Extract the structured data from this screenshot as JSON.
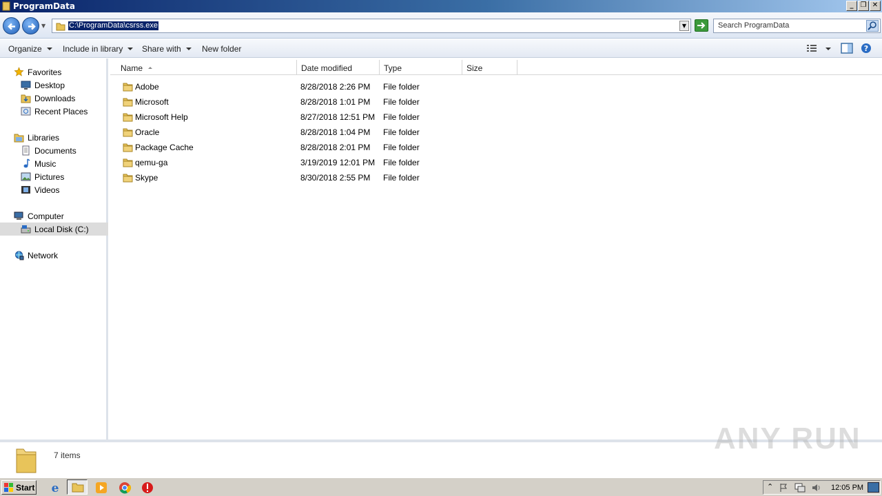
{
  "window": {
    "title": "ProgramData"
  },
  "address": {
    "path": "C:\\ProgramData\\csrss.exe"
  },
  "search": {
    "placeholder": "Search ProgramData"
  },
  "toolbar": {
    "organize": "Organize",
    "include_in_library": "Include in library",
    "share_with": "Share with",
    "new_folder": "New folder"
  },
  "nav": {
    "favorites": "Favorites",
    "desktop": "Desktop",
    "downloads": "Downloads",
    "recent_places": "Recent Places",
    "libraries": "Libraries",
    "documents": "Documents",
    "music": "Music",
    "pictures": "Pictures",
    "videos": "Videos",
    "computer": "Computer",
    "local_disk": "Local Disk (C:)",
    "network": "Network"
  },
  "columns": {
    "name": "Name",
    "date_modified": "Date modified",
    "type": "Type",
    "size": "Size"
  },
  "files": [
    {
      "name": "Adobe",
      "date": "8/28/2018 2:26 PM",
      "type": "File folder"
    },
    {
      "name": "Microsoft",
      "date": "8/28/2018 1:01 PM",
      "type": "File folder"
    },
    {
      "name": "Microsoft Help",
      "date": "8/27/2018 12:51 PM",
      "type": "File folder"
    },
    {
      "name": "Oracle",
      "date": "8/28/2018 1:04 PM",
      "type": "File folder"
    },
    {
      "name": "Package Cache",
      "date": "8/28/2018 2:01 PM",
      "type": "File folder"
    },
    {
      "name": "qemu-ga",
      "date": "3/19/2019 12:01 PM",
      "type": "File folder"
    },
    {
      "name": "Skype",
      "date": "8/30/2018 2:55 PM",
      "type": "File folder"
    }
  ],
  "status": {
    "item_count": "7 items"
  },
  "watermark": "ANY RUN",
  "taskbar": {
    "start": "Start",
    "clock": "12:05 PM"
  },
  "colors": {
    "selection": "#0a246a",
    "title_gradient_start": "#0a246a",
    "folder": "#e8c45a"
  },
  "icons": [
    "folder-icon",
    "back-arrow-icon",
    "forward-arrow-icon",
    "star-icon",
    "desktop-icon",
    "downloads-icon",
    "recent-places-icon",
    "libraries-icon",
    "documents-icon",
    "music-icon",
    "pictures-icon",
    "videos-icon",
    "computer-icon",
    "disk-icon",
    "network-icon",
    "ie-icon",
    "explorer-icon",
    "media-player-icon",
    "chrome-icon",
    "stop-icon",
    "help-icon",
    "views-icon",
    "preview-pane-icon",
    "go-arrow-icon",
    "search-icon"
  ]
}
